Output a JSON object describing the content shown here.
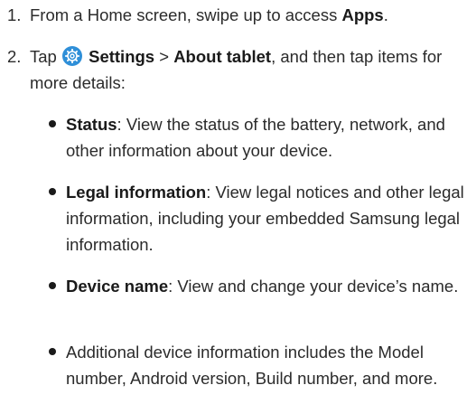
{
  "steps": [
    {
      "number": "1.",
      "pre": "From a Home screen, swipe up to access ",
      "bold": "Apps",
      "post": "."
    },
    {
      "number": "2.",
      "tap": "Tap",
      "settings": "Settings",
      "sep": " > ",
      "about": "About tablet",
      "post": ", and then tap items for more details:",
      "icon": "settings-gear-icon"
    }
  ],
  "bullets": [
    {
      "term": "Status",
      "text": ": View the status of the battery, network, and other information about your device."
    },
    {
      "term": "Legal information",
      "text": ": View legal notices and other legal information, including your embedded Samsung legal information."
    },
    {
      "term": "Device name",
      "text": ": View and change your device’s name."
    },
    {
      "term": "",
      "text": "Additional device information includes the Model number, Android version, Build number, and more."
    }
  ],
  "colors": {
    "icon_accent": "#2f8fd8",
    "text": "#2b2b2b"
  }
}
